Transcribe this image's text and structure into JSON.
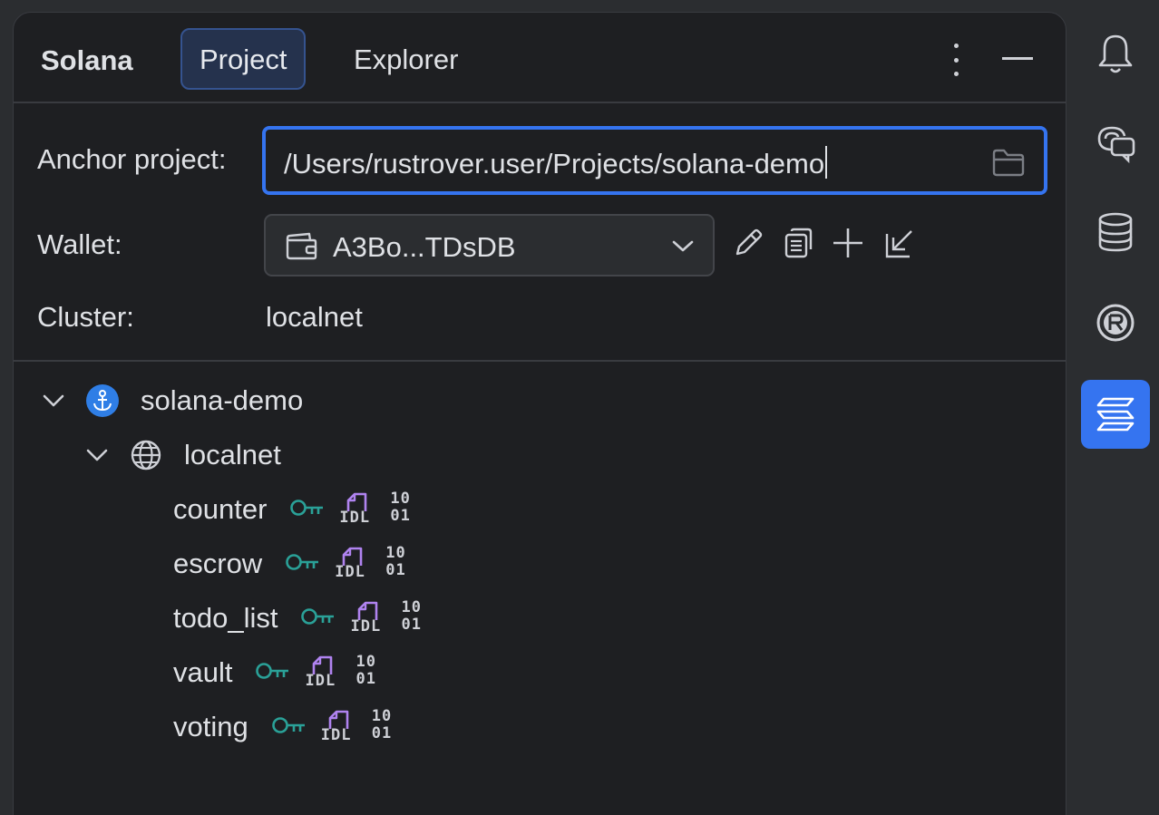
{
  "header": {
    "title": "Solana",
    "tabs": [
      {
        "label": "Project",
        "active": true
      },
      {
        "label": "Explorer",
        "active": false
      }
    ],
    "menu_icon": "kebab-menu-icon",
    "minimize_icon": "minimize-icon"
  },
  "form": {
    "anchor_label": "Anchor project:",
    "anchor_value": "/Users/rustrover.user/Projects/solana-demo",
    "wallet_label": "Wallet:",
    "wallet_value": "A3Bo...TDsDB",
    "cluster_label": "Cluster:",
    "cluster_value": "localnet"
  },
  "tree": {
    "project": "solana-demo",
    "cluster": "localnet",
    "programs": [
      {
        "name": "counter"
      },
      {
        "name": "escrow"
      },
      {
        "name": "todo_list"
      },
      {
        "name": "vault"
      },
      {
        "name": "voting"
      }
    ],
    "idl_label": "IDL",
    "binary_top": "10",
    "binary_bottom": "01"
  },
  "colors": {
    "accent": "#3574f0",
    "key": "#2aa198",
    "idl": "#b083f0",
    "anchor_badge": "#2f7ee6"
  },
  "sidebar_icons": [
    "bell-icon",
    "ai-chat-icon",
    "database-icon",
    "rust-icon",
    "solana-icon"
  ]
}
